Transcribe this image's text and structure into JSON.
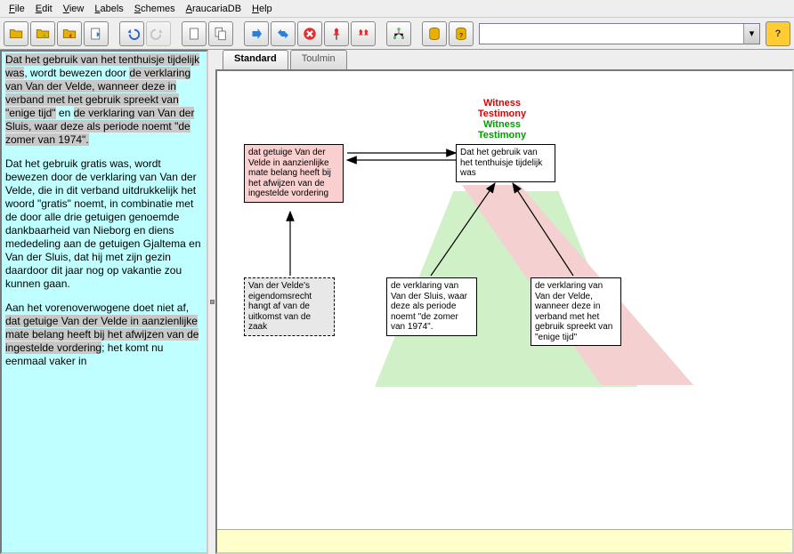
{
  "menu": {
    "items": [
      "File",
      "Edit",
      "View",
      "Labels",
      "Schemes",
      "AraucariaDB",
      "Help"
    ]
  },
  "toolbar": {
    "icons": [
      "open",
      "open-folder",
      "save",
      "export",
      "undo",
      "redo",
      "new-doc",
      "copy-doc",
      "forward",
      "swap",
      "cancel",
      "pin",
      "link-pin",
      "tree",
      "db",
      "db-help"
    ],
    "combo_value": "",
    "help_label": "?"
  },
  "tabs": {
    "items": [
      "Standard",
      "Toulmin"
    ],
    "active": 0
  },
  "left_text": {
    "p1_pre": "",
    "p1_hl1": "Dat het gebruik van het tenthuisje tijdelijk was",
    "p1_mid1": ", wordt bewezen door ",
    "p1_hl2": "de verklaring van Van der Velde, wanneer deze\nin verband met het gebruik spreekt van \"enige tijd\"",
    "p1_mid2": " en ",
    "p1_hl3": "de verklaring van Van der Sluis, waar deze als periode noemt\n\"de zomer van 1974\".",
    "p2": "Dat het gebruik gratis was, wordt bewezen door de verklaring van Van der Velde, die in dit verband uitdrukkelijk het\nwoord \"gratis\" noemt, in combinatie met de door alle drie getuigen genoemde dankbaarheid van Nieborg en diens\nmededeling aan de getuigen Gjaltema en Van der Sluis, dat hij met zijn gezin daardoor dit jaar nog op vakantie zou\nkunnen gaan.",
    "p3_pre": "Aan het vorenoverwogene doet niet af, ",
    "p3_hl": "dat getuige Van der Velde in aanzienlijke mate belang heeft bij het afwijzen\nvan de ingestelde vordering",
    "p3_post": "; het komt nu eenmaal vaker in"
  },
  "diagram": {
    "labels": {
      "red1": "Witness",
      "red2": "Testimony",
      "green1": "Witness",
      "green2": "Testimony"
    },
    "nodes": {
      "n_pink": "dat getuige Van der\nVelde in aanzienlijke\nmate belang heeft bij\nhet afwijzen\nvan de ingestelde\nvordering",
      "n_top": "Dat het gebruik van\nhet tenthuisje tijdelijk\nwas",
      "n_dashed": "Van der Velde's\neigendomsrecht\nhangt af van de\nuitkomst van de\nzaak",
      "n_mid": "de verklaring van\nVan der Sluis, waar\ndeze als periode\nnoemt\n\"de zomer van\n1974\".",
      "n_right": "de verklaring van\nVan der Velde,\nwanneer deze\nin verband met het\ngebruik spreekt van\n\"enige tijd\""
    }
  }
}
